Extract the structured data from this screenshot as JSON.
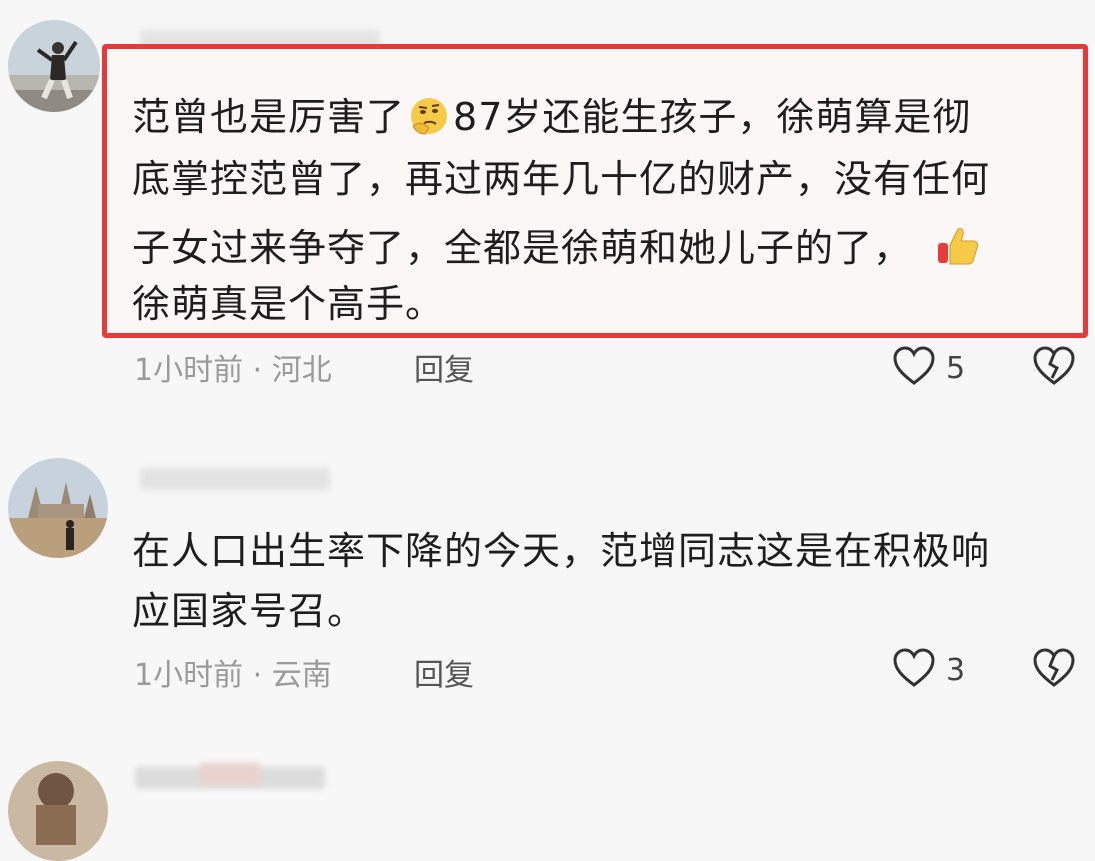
{
  "comments": [
    {
      "text_lines": [
        "范曾也是厉害了",
        "87岁还能生孩子，徐萌算是彻",
        "底掌控范曾了，再过两年几十亿的财产，没有任何",
        "子女过来争夺了，全都是徐萌和她儿子的了，",
        "徐萌真是个高手。"
      ],
      "time": "1小时前",
      "location": "河北",
      "meta_separator": "·",
      "reply_label": "回复",
      "like_count": "5",
      "highlighted": true,
      "emojis": [
        "thinking-face-icon",
        "thumbs-up-icon"
      ]
    },
    {
      "text_lines": [
        "在人口出生率下降的今天，范增同志这是在积极响",
        "应国家号召。"
      ],
      "time": "1小时前",
      "location": "云南",
      "meta_separator": "·",
      "reply_label": "回复",
      "like_count": "3",
      "highlighted": false
    }
  ],
  "colors": {
    "highlight_border": "#e63a3a",
    "meta_text": "#9a9a9a",
    "body_text": "#1e1e1e"
  },
  "icons": {
    "like": "heart-outline-icon",
    "dislike": "broken-heart-icon"
  }
}
